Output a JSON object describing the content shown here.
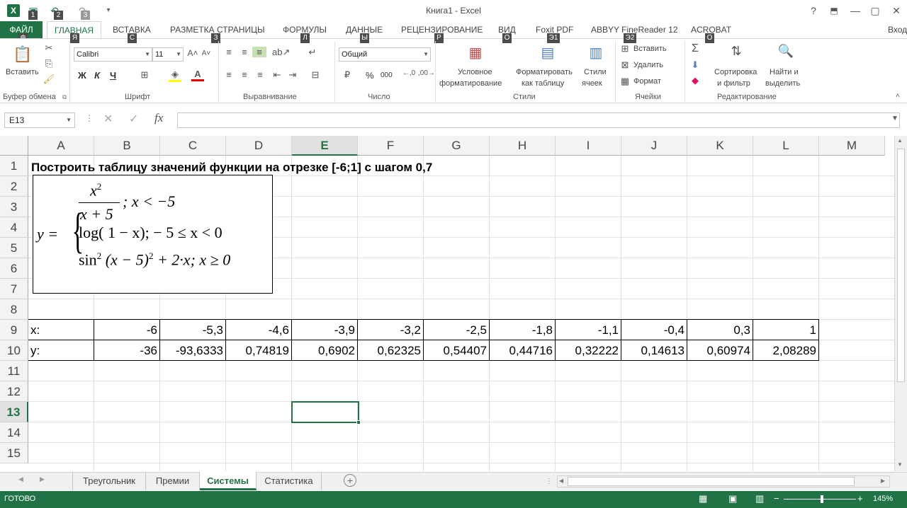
{
  "window": {
    "title": "Книга1 - Excel",
    "signin": "Вход",
    "help": "?",
    "minimize": "—",
    "restore": "▢",
    "close": "✕"
  },
  "quick_access": {
    "keytips": [
      "1",
      "2",
      "3"
    ]
  },
  "tabs": {
    "file": "ФАЙЛ",
    "items": [
      {
        "label": "ГЛАВНАЯ",
        "active": true,
        "keytip": "Я"
      },
      {
        "label": "ВСТАВКА",
        "keytip": "С"
      },
      {
        "label": "РАЗМЕТКА СТРАНИЦЫ",
        "keytip": "З"
      },
      {
        "label": "ФОРМУЛЫ",
        "keytip": "Л"
      },
      {
        "label": "ДАННЫЕ",
        "keytip": "Ы"
      },
      {
        "label": "РЕЦЕНЗИРОВАНИЕ",
        "keytip": "Р"
      },
      {
        "label": "ВИД",
        "keytip": "О"
      },
      {
        "label": "Foxit PDF",
        "keytip": "Э1"
      },
      {
        "label": "ABBYY FineReader 12",
        "keytip": "Э2"
      },
      {
        "label": "ACROBAT",
        "keytip": "О"
      }
    ],
    "file_keytip": "Ф"
  },
  "ribbon": {
    "clipboard": {
      "paste": "Вставить",
      "label": "Буфер обмена"
    },
    "font": {
      "name": "Calibri",
      "size": "11",
      "bold": "Ж",
      "italic": "К",
      "underline": "Ч",
      "label": "Шрифт"
    },
    "alignment": {
      "label": "Выравнивание"
    },
    "number": {
      "format": "Общий",
      "percent": "%",
      "thousands": "000",
      "label": "Число"
    },
    "styles": {
      "conditional_1": "Условное",
      "conditional_2": "форматирование",
      "astable_1": "Форматировать",
      "astable_2": "как таблицу",
      "cellstyles_1": "Стили",
      "cellstyles_2": "ячеек",
      "label": "Стили"
    },
    "cells": {
      "insert": "Вставить",
      "delete": "Удалить",
      "format": "Формат",
      "label": "Ячейки"
    },
    "editing": {
      "sort_1": "Сортировка",
      "sort_2": "и фильтр",
      "find_1": "Найти и",
      "find_2": "выделить",
      "label": "Редактирование"
    }
  },
  "formula_bar": {
    "name_box": "E13",
    "fx": "fx",
    "value": ""
  },
  "columns": [
    "A",
    "B",
    "C",
    "D",
    "E",
    "F",
    "G",
    "H",
    "I",
    "J",
    "K",
    "L",
    "M"
  ],
  "selected_column": "E",
  "rows": [
    "1",
    "2",
    "3",
    "4",
    "5",
    "6",
    "7",
    "8",
    "9",
    "10",
    "11",
    "12",
    "13",
    "14",
    "15"
  ],
  "selected_row": "13",
  "sheet": {
    "title": "Построить таблицу значений функции на отрезке [-6;1] с шагом 0,7",
    "row9_label": "x:",
    "row10_label": "y:",
    "x_values": [
      "-6",
      "-5,3",
      "-4,6",
      "-3,9",
      "-3,2",
      "-2,5",
      "-1,8",
      "-1,1",
      "-0,4",
      "0,3",
      "1"
    ],
    "y_values": [
      "-36",
      "-93,6333",
      "0,74819",
      "0,6902",
      "0,62325",
      "0,54407",
      "0,44716",
      "0,32222",
      "0,14613",
      "0,60974",
      "2,08289"
    ]
  },
  "formula_image": {
    "y_eq": "y =",
    "case1_num": "x",
    "case1_num_exp": "2",
    "case1_den": "x + 5",
    "case1_cond": "; x < −5",
    "case2": "log( 1 − x);  − 5 ≤ x < 0",
    "case3_a": "sin",
    "case3_exp1": "2",
    "case3_b": " (x − 5)",
    "case3_exp2": "2",
    "case3_c": " + 2·x;  x ≥ 0"
  },
  "sheet_tabs": [
    {
      "label": "Треугольник",
      "active": false
    },
    {
      "label": "Премии",
      "active": false
    },
    {
      "label": "Системы",
      "active": true
    },
    {
      "label": "Статистика",
      "active": false
    }
  ],
  "status": {
    "ready": "ГОТОВО",
    "zoom": "145%"
  }
}
